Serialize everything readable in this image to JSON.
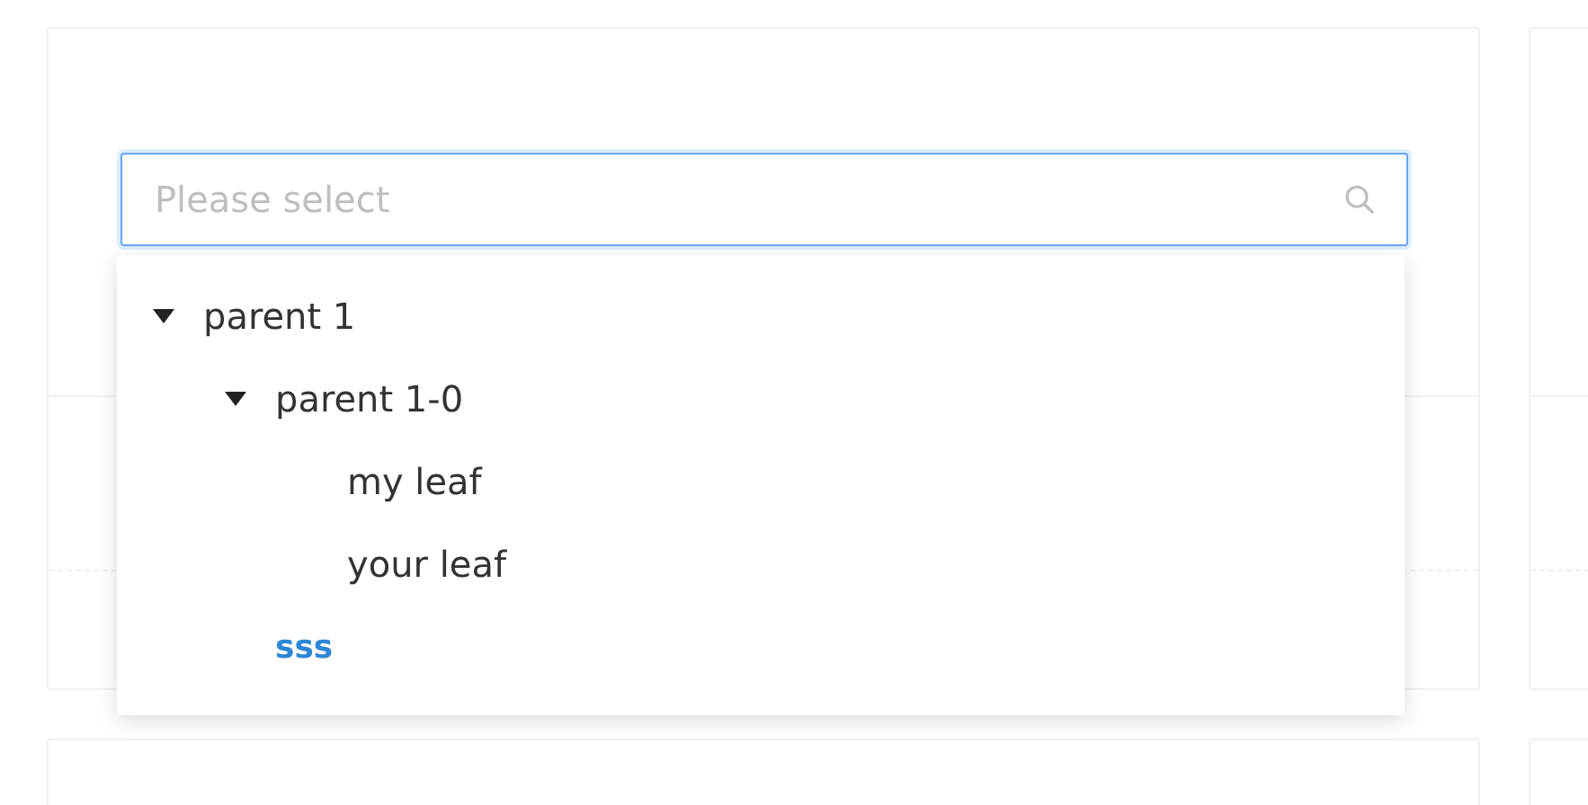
{
  "tree_select": {
    "placeholder": "Please select",
    "tree": [
      {
        "label": "parent 1",
        "expanded": true,
        "selected": false,
        "children": [
          {
            "label": "parent 1-0",
            "expanded": true,
            "selected": false,
            "children": [
              {
                "label": "my leaf",
                "selected": false
              },
              {
                "label": "your leaf",
                "selected": false
              }
            ]
          },
          {
            "label": "sss",
            "selected": true
          }
        ]
      }
    ]
  }
}
